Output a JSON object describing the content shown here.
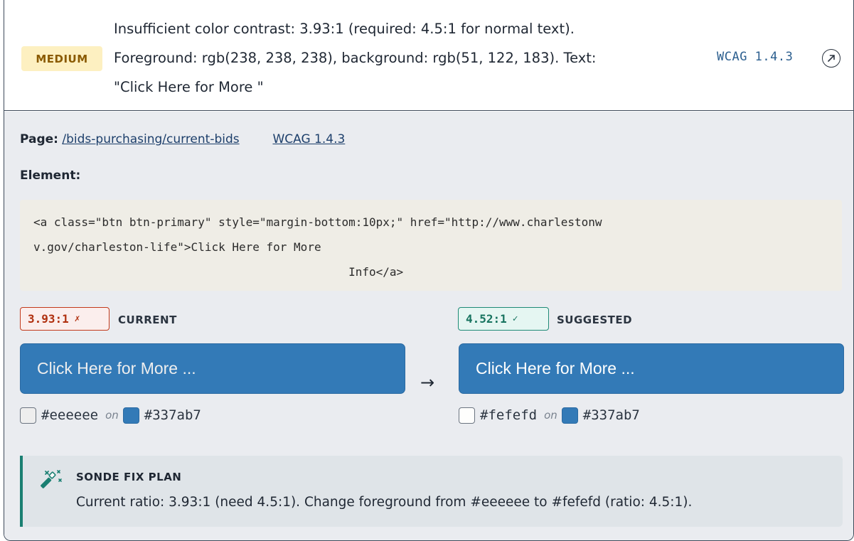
{
  "issue": {
    "severity": "MEDIUM",
    "message_lines": [
      "Insufficient color contrast: 3.93:1 (required: 4.5:1 for normal text).",
      "Foreground: rgb(238, 238, 238), background: rgb(51, 122, 183). Text:",
      "\"Click Here for More \""
    ],
    "wcag_ref": "WCAG 1.4.3",
    "external_icon": "external-link-icon"
  },
  "details": {
    "page_label": "Page:",
    "page_path": "/bids-purchasing/current-bids",
    "wcag_link": "WCAG 1.4.3",
    "element_label": "Element:",
    "element_code": "<a class=\"btn btn-primary\" style=\"margin-bottom:10px;\" href=\"http://www.charlestonw\nv.gov/charleston-life\">Click Here for More\n                                              Info</a>"
  },
  "current": {
    "ratio": "3.93:1",
    "mark": "✗",
    "label": "CURRENT",
    "preview_text": "Click Here for More ...",
    "fg_hex": "#eeeeee",
    "bg_hex": "#337ab7",
    "on_text": "on",
    "fg_color": "#eeeeee",
    "bg_color": "#337ab7"
  },
  "suggested": {
    "ratio": "4.52:1",
    "mark": "✓",
    "label": "SUGGESTED",
    "preview_text": "Click Here for More ...",
    "fg_hex": "#fefefd",
    "bg_hex": "#337ab7",
    "on_text": "on",
    "fg_color": "#fefefd",
    "bg_color": "#337ab7"
  },
  "arrow": "→",
  "fix_plan": {
    "icon": "magic-wand-icon",
    "title": "SONDE FIX PLAN",
    "text": "Current ratio: 3.93:1 (need 4.5:1). Change foreground from #eeeeee to #fefefd (ratio: 4.5:1)."
  },
  "colors": {
    "severity_bg": "#fdf0c1",
    "severity_fg": "#8a5a00",
    "fail": "#b0300f",
    "pass": "#17735f",
    "accent": "#1a7f72"
  }
}
